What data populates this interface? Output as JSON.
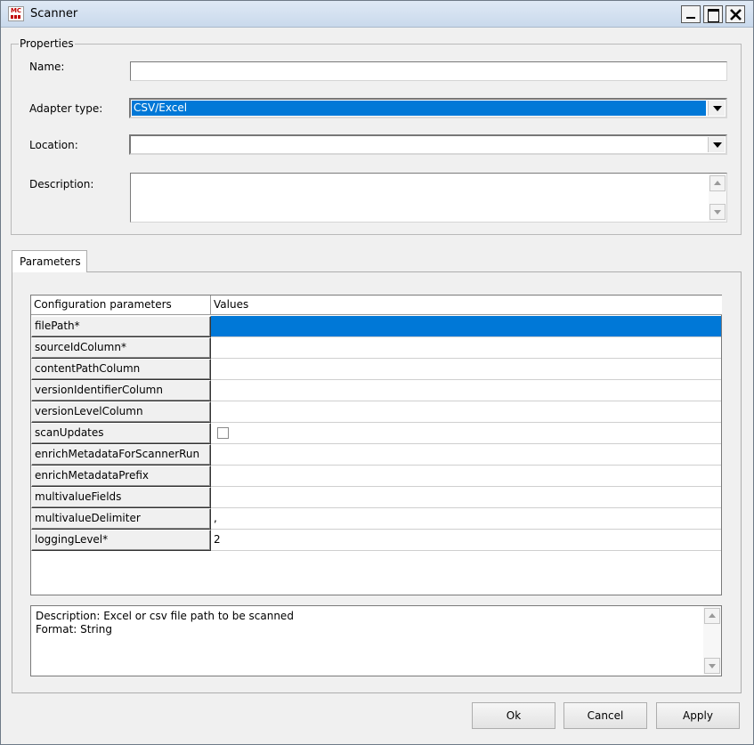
{
  "window": {
    "title": "Scanner",
    "icon_text": "MC",
    "icon_name": "app-icon"
  },
  "properties": {
    "group_label": "Properties",
    "name_label": "Name:",
    "name_value": "",
    "adapter_label": "Adapter type:",
    "adapter_value": "CSV/Excel",
    "location_label": "Location:",
    "location_value": "",
    "description_label": "Description:",
    "description_value": ""
  },
  "tabs": [
    {
      "label": "Parameters",
      "selected": true
    }
  ],
  "table": {
    "headers": [
      "Configuration parameters",
      "Values"
    ],
    "rows": [
      {
        "name": "filePath*",
        "value": "",
        "selected": true
      },
      {
        "name": "sourceIdColumn*",
        "value": ""
      },
      {
        "name": "contentPathColumn",
        "value": ""
      },
      {
        "name": "versionIdentifierColumn",
        "value": ""
      },
      {
        "name": "versionLevelColumn",
        "value": ""
      },
      {
        "name": "scanUpdates",
        "value": "",
        "type": "checkbox",
        "checked": false
      },
      {
        "name": "enrichMetadataForScannerRun",
        "value": ""
      },
      {
        "name": "enrichMetadataPrefix",
        "value": ""
      },
      {
        "name": "multivalueFields",
        "value": ""
      },
      {
        "name": "multivalueDelimiter",
        "value": ","
      },
      {
        "name": "loggingLevel*",
        "value": "2"
      }
    ]
  },
  "param_description": {
    "line1": "Description: Excel or csv file path to be scanned",
    "line2": "Format: String"
  },
  "buttons": {
    "ok": "Ok",
    "cancel": "Cancel",
    "apply": "Apply"
  },
  "colors": {
    "selection": "#0078d7"
  }
}
